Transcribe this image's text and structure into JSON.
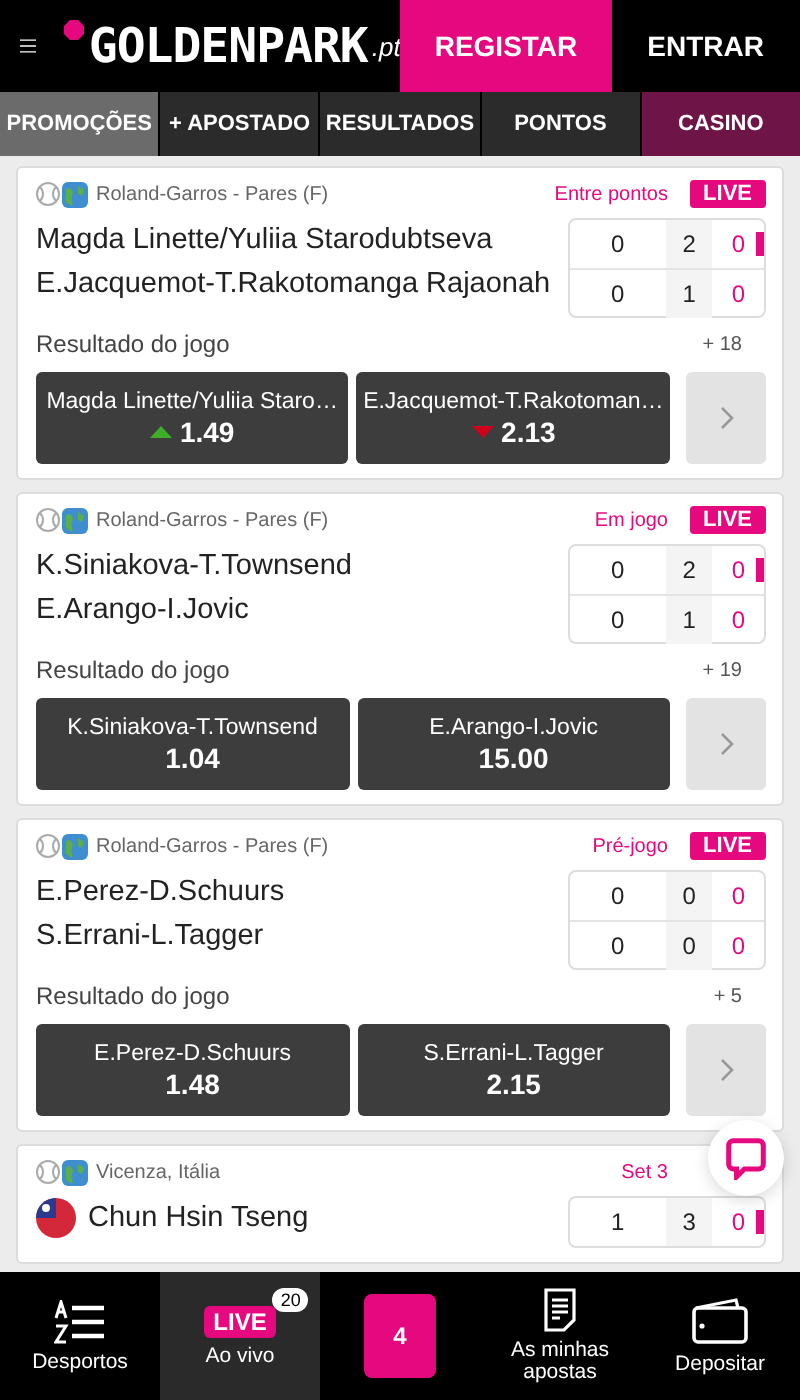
{
  "header": {
    "logo": "GOLDENPARK",
    "logo_suffix": ".pt",
    "buttons": [
      {
        "label": "REGISTAR",
        "kind": "primary"
      },
      {
        "label": "ENTRAR",
        "kind": "plain"
      }
    ]
  },
  "tabs": [
    {
      "label": "PROMOÇÕES",
      "selected": true,
      "kind": "normal"
    },
    {
      "label": "+ APOSTADO",
      "selected": false,
      "kind": "normal"
    },
    {
      "label": "RESULTADOS",
      "selected": false,
      "kind": "normal"
    },
    {
      "label": "PONTOS",
      "selected": false,
      "kind": "normal"
    },
    {
      "label": "CASINO",
      "selected": false,
      "kind": "casino"
    }
  ],
  "events": [
    {
      "competition": "Roland-Garros - Pares (F)",
      "status": "Entre pontos",
      "live_badge": "LIVE",
      "teams": [
        {
          "name": "Magda Linette/Yuliia Starodubtseva",
          "serving": true,
          "scores": [
            "0",
            "2",
            "0"
          ]
        },
        {
          "name": "E.Jacquemot-T.Rakotomanga Rajaonah",
          "serving": false,
          "scores": [
            "0",
            "1",
            "0"
          ]
        }
      ],
      "market": "Resultado do jogo",
      "more": "+ 18",
      "odds": [
        {
          "label": "Magda Linette/Yuliia Staro…",
          "price": "1.49",
          "rising": true
        },
        {
          "label": "E.Jacquemot-T.Rakotoman…",
          "price": "2.13",
          "rising": false
        }
      ]
    },
    {
      "competition": "Roland-Garros - Pares (F)",
      "status": "Em jogo",
      "live_badge": "LIVE",
      "teams": [
        {
          "name": "K.Siniakova-T.Townsend",
          "serving": true,
          "scores": [
            "0",
            "2",
            "0"
          ]
        },
        {
          "name": "E.Arango-I.Jovic",
          "serving": false,
          "scores": [
            "0",
            "1",
            "0"
          ]
        }
      ],
      "market": "Resultado do jogo",
      "more": "+ 19",
      "odds": [
        {
          "label": "K.Siniakova-T.Townsend",
          "price": "1.04"
        },
        {
          "label": "E.Arango-I.Jovic",
          "price": "15.00"
        }
      ]
    },
    {
      "competition": "Roland-Garros - Pares (F)",
      "status": "Pré-jogo",
      "live_badge": "LIVE",
      "teams": [
        {
          "name": "E.Perez-D.Schuurs",
          "serving": false,
          "scores": [
            "0",
            "0",
            "0"
          ]
        },
        {
          "name": "S.Errani-L.Tagger",
          "serving": false,
          "scores": [
            "0",
            "0",
            "0"
          ]
        }
      ],
      "market": "Resultado do jogo",
      "more": "+ 5",
      "odds": [
        {
          "label": "E.Perez-D.Schuurs",
          "price": "1.48"
        },
        {
          "label": "S.Errani-L.Tagger",
          "price": "2.15"
        }
      ]
    },
    {
      "competition": "Vicenza, Itália",
      "status": "Set 3",
      "teams": [
        {
          "name": "Chun Hsin Tseng",
          "flag": true,
          "serving": true,
          "scores": [
            "1",
            "3",
            "0"
          ]
        }
      ]
    }
  ],
  "bottom_nav": [
    {
      "label": "Desportos",
      "kind": "az",
      "selected": false
    },
    {
      "label": "Ao vivo",
      "kind": "live",
      "badge_text": "LIVE",
      "count": "20",
      "selected": true
    },
    {
      "kind": "betslip",
      "count": "4",
      "selected": false
    },
    {
      "label": "As minhas apostas",
      "kind": "bets",
      "selected": false
    },
    {
      "label": "Depositar",
      "kind": "wallet",
      "selected": false
    }
  ]
}
